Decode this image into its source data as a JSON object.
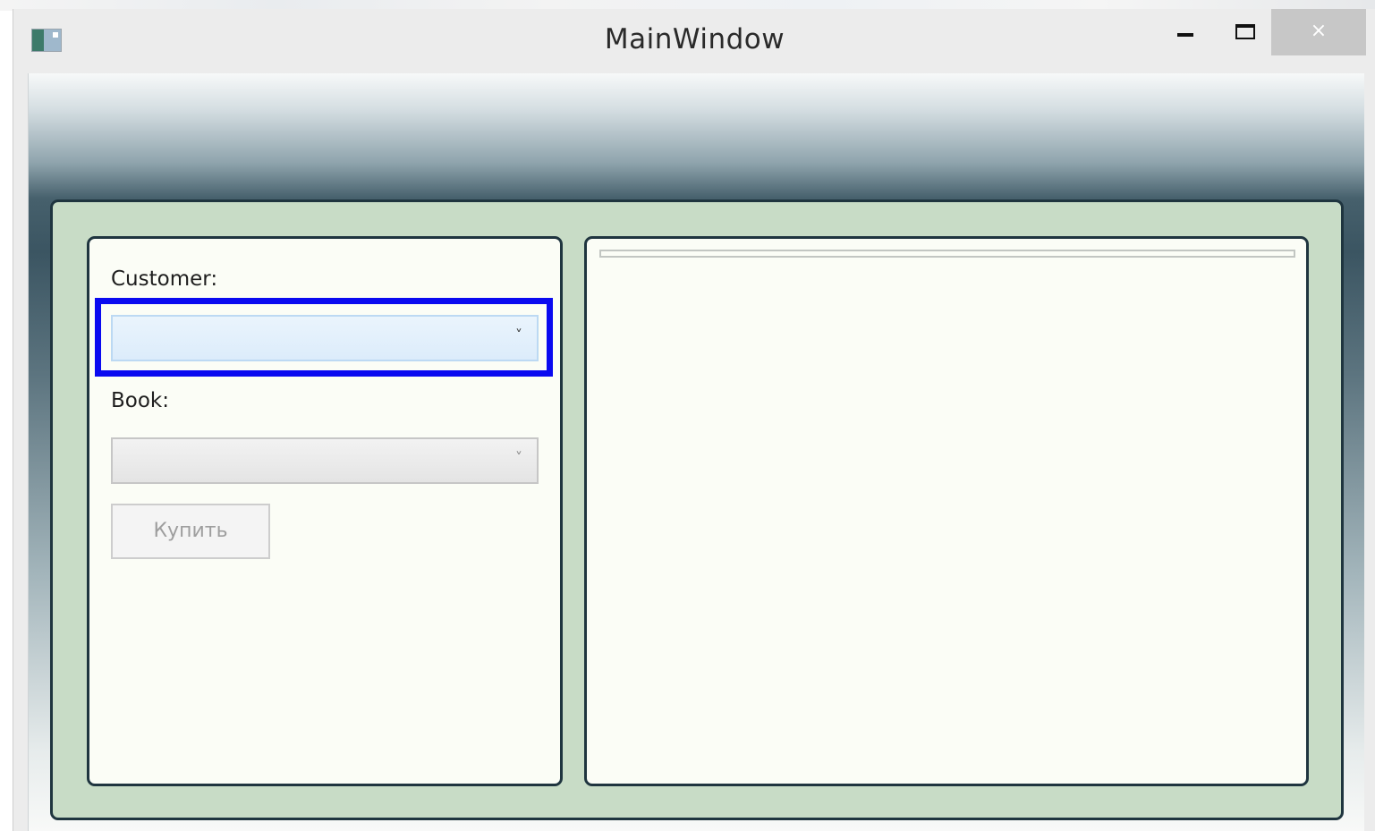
{
  "window": {
    "title": "MainWindow",
    "close_glyph": "×",
    "icons": {
      "app": "app-icon",
      "minimize": "minimize-icon",
      "maximize": "maximize-icon",
      "close": "close-icon"
    }
  },
  "form": {
    "customer_label": "Customer:",
    "customer_value": "",
    "book_label": "Book:",
    "book_value": "",
    "dropdown_glyph": "˅",
    "buy_button_label": "Купить"
  },
  "colors": {
    "panel_green": "#c8dcc6",
    "panel_border": "#1f353f",
    "focus_ring": "#0a0af0",
    "panel_fill": "#fbfdf6"
  }
}
